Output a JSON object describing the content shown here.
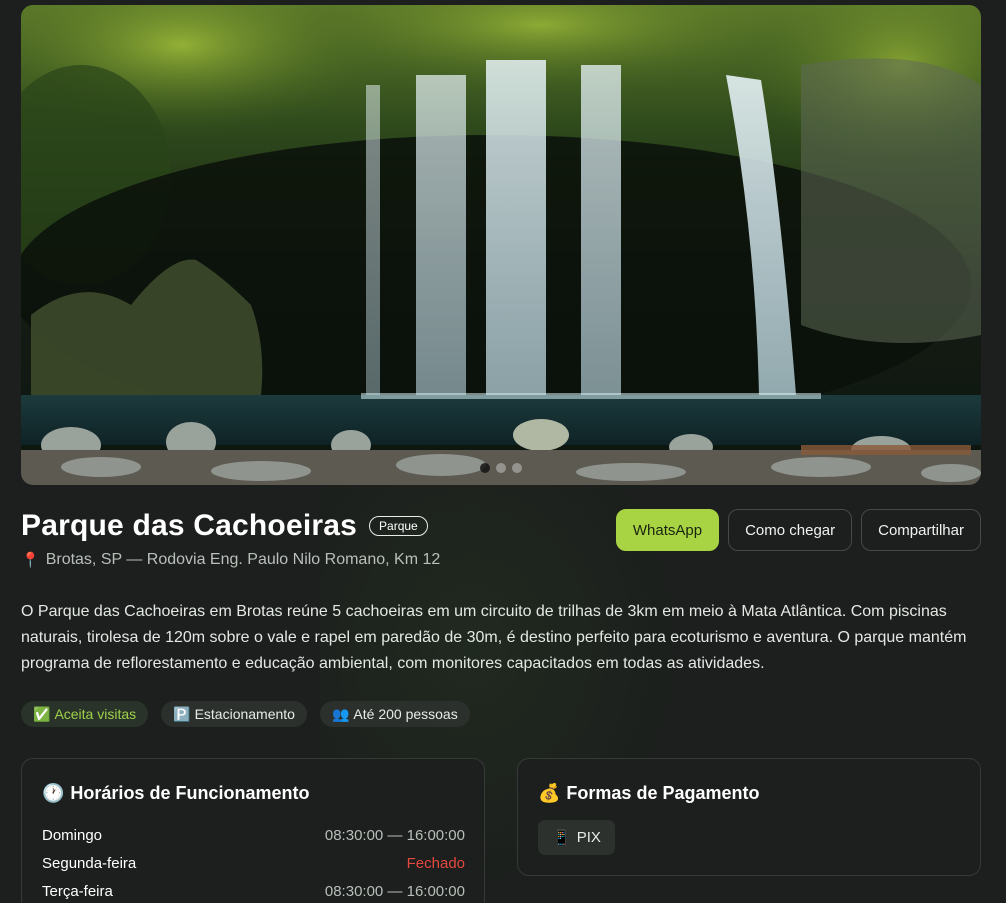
{
  "hero": {
    "slides": 3,
    "active_slide": 1
  },
  "place": {
    "name": "Parque das Cachoeiras",
    "category": "Parque",
    "location": "Brotas, SP — Rodovia Eng. Paulo Nilo Romano, Km 12",
    "location_icon": "📍"
  },
  "actions": {
    "whatsapp": "WhatsApp",
    "directions": "Como chegar",
    "share": "Compartilhar"
  },
  "description": "O Parque das Cachoeiras em Brotas reúne 5 cachoeiras em um circuito de trilhas de 3km em meio à Mata Atlântica. Com piscinas naturais, tirolesa de 120m sobre o vale e rapel em paredão de 30m, é destino perfeito para ecoturismo e aventura. O parque mantém programa de reflorestamento e educação ambiental, com monitores capacitados em todas as atividades.",
  "features": [
    {
      "icon": "✅",
      "label": "Aceita visitas"
    },
    {
      "icon": "🅿️",
      "label": "Estacionamento"
    },
    {
      "icon": "👥",
      "label": "Até 200 pessoas"
    }
  ],
  "hours": {
    "icon": "🕐",
    "title": "Horários de Funcionamento",
    "rows": [
      {
        "day": "Domingo",
        "time": "08:30:00 — 16:00:00"
      },
      {
        "day": "Segunda-feira",
        "time": "Fechado"
      },
      {
        "day": "Terça-feira",
        "time": "08:30:00 — 16:00:00"
      }
    ]
  },
  "payment": {
    "icon": "💰",
    "title": "Formas de Pagamento",
    "methods": [
      {
        "icon": "📱",
        "label": "PIX"
      }
    ]
  },
  "colors": {
    "accent": "#a8d444",
    "background": "#1c1f1d",
    "closed": "#e5483e"
  }
}
